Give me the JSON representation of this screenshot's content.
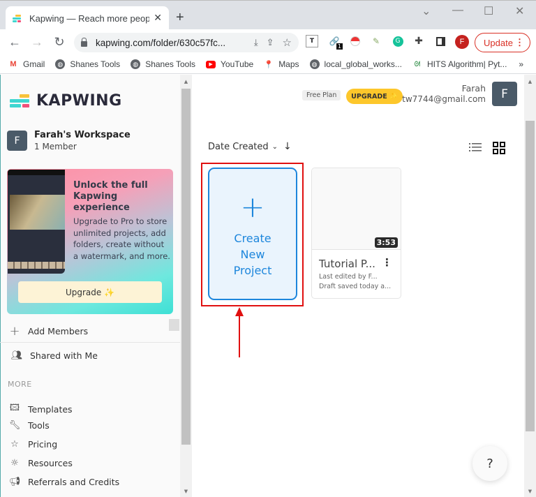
{
  "browser": {
    "tab_title": "Kapwing — Reach more people w",
    "new_tab": "+",
    "window_controls": {
      "chevron": "⌄",
      "minimize": "—",
      "maximize": "☐",
      "close": "✕"
    },
    "url": "kapwing.com/folder/630c57fc...",
    "update_label": "Update",
    "profile_initial": "F",
    "extensions": [
      "text-extension-icon",
      "link-extension-icon",
      "pokeball-extension-icon",
      "eyedropper-extension-icon",
      "grammarly-icon",
      "puzzle-icon",
      "side-panel-icon"
    ],
    "extension_badge": "1",
    "bookmarks": [
      {
        "label": "Gmail",
        "icon": "gmail-icon"
      },
      {
        "label": "Shanes Tools",
        "icon": "globe-icon"
      },
      {
        "label": "Shanes Tools",
        "icon": "globe-icon"
      },
      {
        "label": "YouTube",
        "icon": "youtube-icon"
      },
      {
        "label": "Maps",
        "icon": "maps-icon"
      },
      {
        "label": "local_global_works...",
        "icon": "globe-icon"
      },
      {
        "label": "HITS Algorithm| Pyt...",
        "icon": "gfg-icon"
      }
    ],
    "bookmarks_overflow": "»"
  },
  "sidebar": {
    "logo_text": "KAPWING",
    "workspace": {
      "initial": "F",
      "name": "Farah's Workspace",
      "members": "1 Member"
    },
    "promo": {
      "title": "Unlock the full Kapwing experience",
      "description": "Upgrade to Pro to store unlimited projects, add folders, create without a watermark, and more.",
      "button": "Upgrade ✨"
    },
    "add_members": "Add Members",
    "shared": "Shared with Me",
    "more_heading": "MORE",
    "more_items": [
      {
        "label": "Templates",
        "icon": "image-icon"
      },
      {
        "label": "Tools",
        "icon": "wrench-icon"
      },
      {
        "label": "Pricing",
        "icon": "star-icon"
      },
      {
        "label": "Resources",
        "icon": "lightbulb-icon"
      },
      {
        "label": "Referrals and Credits",
        "icon": "megaphone-icon"
      }
    ]
  },
  "header": {
    "plan_badge": "Free Plan",
    "upgrade_label": "UPGRADE ✨",
    "user_name": "Farah",
    "user_email": "tw7744@gmail.com",
    "user_initial": "F"
  },
  "main": {
    "sort_label": "Date Created",
    "create_project": {
      "icon": "+",
      "label": "Create New Project"
    },
    "projects": [
      {
        "title": "Tutorial P...",
        "duration": "3:53",
        "edited_by": "Last edited by F...",
        "saved": "Draft saved today a..."
      }
    ],
    "help_label": "?"
  },
  "colors": {
    "accent": "#1d86dc",
    "upgrade_yellow": "#fdc72b",
    "highlight_red": "#e01010",
    "chrome_update_red": "#d93025"
  }
}
